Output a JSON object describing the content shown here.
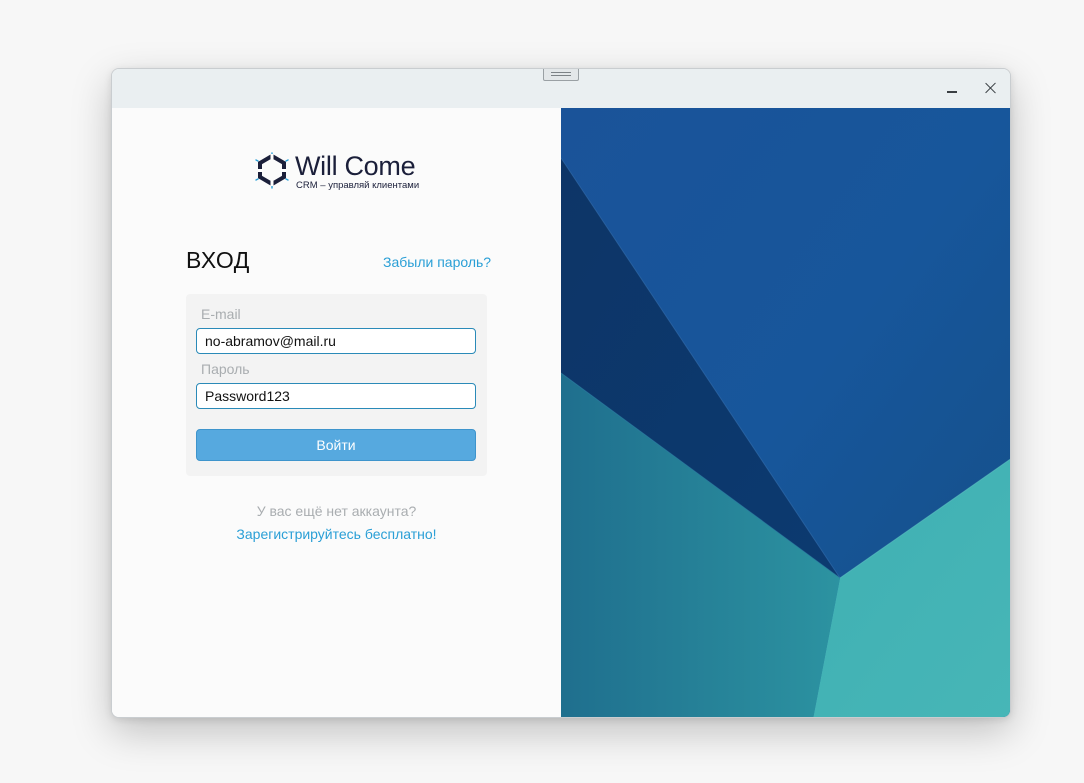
{
  "window": {
    "controls": {
      "minimize_icon": "minimize-icon",
      "close_icon": "close-icon"
    }
  },
  "logo": {
    "title": "Will Come",
    "subtitle": "CRM – управляй клиентами",
    "icon": "logo-mark-icon"
  },
  "login": {
    "heading": "ВХОД",
    "forgot_link": "Забыли пароль?",
    "email_label": "E-mail",
    "email_value": "no-abramov@mail.ru",
    "password_label": "Пароль",
    "password_value": "Password123",
    "submit_label": "Войти"
  },
  "signup": {
    "prompt": "У вас ещё нет аккаунта?",
    "link": "Зарегистрируйтесь бесплатно!"
  },
  "colors": {
    "accent": "#2a9fd6",
    "button": "#56a9df",
    "dark_blue": "#0e3a6e",
    "mid_blue": "#1a5599",
    "teal": "#44b4b5"
  }
}
